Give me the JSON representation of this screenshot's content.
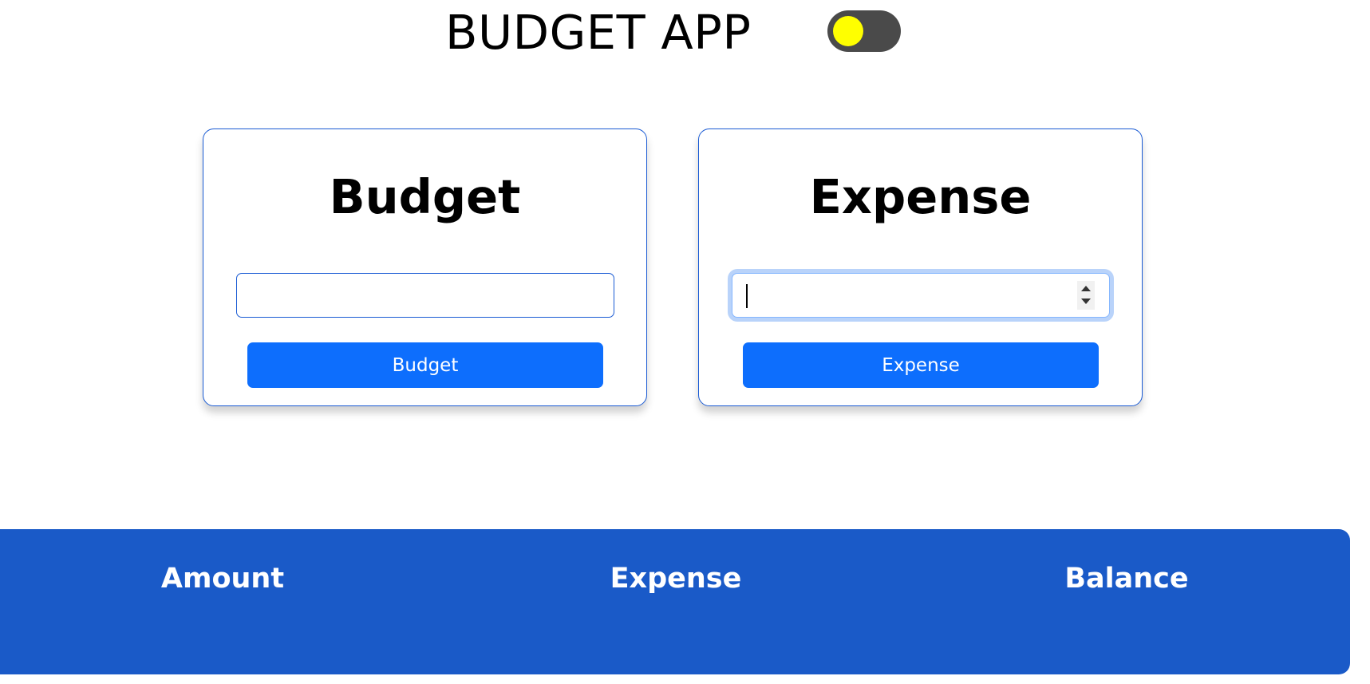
{
  "header": {
    "title": "BUDGET APP",
    "theme_toggle": {
      "state": "dark",
      "knob_color": "#ffff00",
      "track_color": "#4a4a4a"
    }
  },
  "budget_card": {
    "title": "Budget",
    "input_value": "",
    "button_label": "Budget"
  },
  "expense_card": {
    "title": "Expense",
    "input_value": "",
    "input_type": "number",
    "focused": true,
    "button_label": "Expense"
  },
  "summary": {
    "amount_label": "Amount",
    "expense_label": "Expense",
    "balance_label": "Balance",
    "background": "#1a5ac8"
  },
  "colors": {
    "primary": "#0d6efd",
    "border": "#1a5bd4"
  }
}
